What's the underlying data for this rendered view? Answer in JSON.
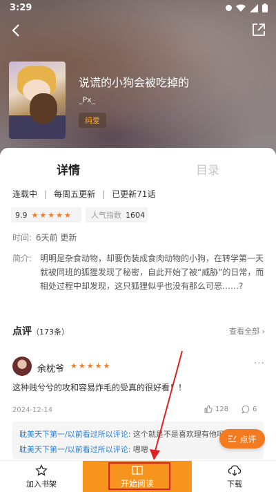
{
  "status_bar": {
    "time": "3:29"
  },
  "book": {
    "title": "说谎的小狗会被吃掉的",
    "author": "_Px_",
    "genre_tag": "纯爱"
  },
  "tabs": {
    "detail": "详情",
    "toc": "目录"
  },
  "meta": {
    "status": "连载中",
    "schedule": "每周五更新",
    "chapters": "已更新71话"
  },
  "rating": {
    "score": "9.9",
    "stars": 5,
    "popularity_label": "人气指数",
    "popularity_value": "1604"
  },
  "update_time": {
    "label": "时间:",
    "value": "6天前 更新"
  },
  "intro": {
    "label": "简介:",
    "text": "明明是杂食动物，却要伪装成食肉动物的小狗，在转学第一天就被同班的狐狸发现了秘密，自此开始了被“威胁”的日常，而相处过程中却发现，这只狐狸似乎也没有那么可恶……?"
  },
  "comments": {
    "heading": "点评",
    "count": "（173条）",
    "see_all": "查看全部",
    "items": [
      {
        "user": "余枕爷",
        "stars": 5,
        "text": "这种贱兮兮的攻和容易炸毛的受真的很好看！！",
        "date": "2024-12-14",
        "likes": "128",
        "replies": "6"
      }
    ],
    "reply_previews": [
      {
        "who": "耽美天下第一/以前看过所以评论:",
        "text": " 这个就是不是喜欢理有他吗哥"
      },
      {
        "who": "耽美天下第一/以前看过所以评论:",
        "text": " 嗯嗯"
      }
    ]
  },
  "fab": {
    "label": "点评"
  },
  "bottom_bar": {
    "shelf": "加入书架",
    "read": "开始阅读",
    "download": "下载"
  },
  "colors": {
    "accent": "#f7941e",
    "star": "#f07b2c",
    "link": "#2f7fd6",
    "annotation": "#e02020"
  }
}
